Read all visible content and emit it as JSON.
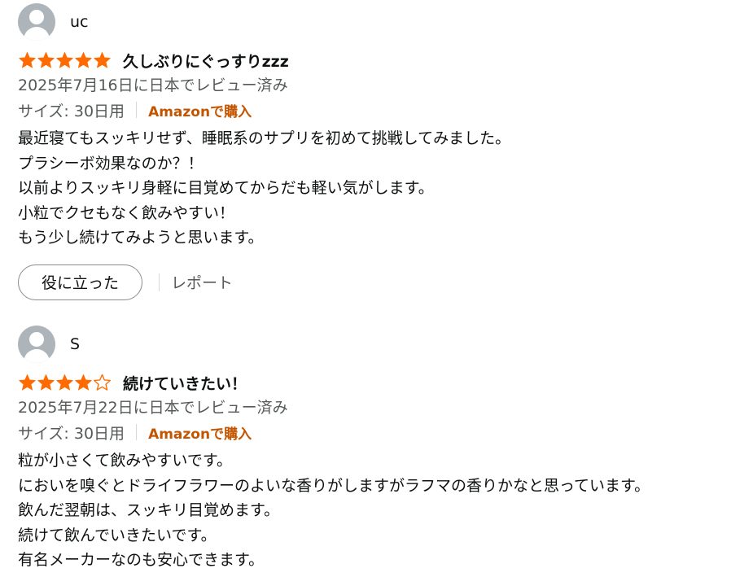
{
  "reviews": [
    {
      "reviewer": "uc",
      "rating": 5,
      "title": "久しぶりにぐっすりzzz",
      "date": "2025年7月16日に日本でレビュー済み",
      "size": "サイズ: 30日用",
      "verified": "Amazonで購入",
      "body": [
        "最近寝てもスッキリせず、睡眠系のサプリを初めて挑戦してみました。",
        "プラシーボ効果なのか？！",
        "以前よりスッキリ身軽に目覚めてからだも軽い気がします。",
        "小粒でクセもなく飲みやすい！",
        "もう少し続けてみようと思います。"
      ],
      "helpful_label": "役に立った",
      "report_label": "レポート"
    },
    {
      "reviewer": "S",
      "rating": 4,
      "title": "続けていきたい！",
      "date": "2025年7月22日に日本でレビュー済み",
      "size": "サイズ: 30日用",
      "verified": "Amazonで購入",
      "body": [
        "粒が小さくて飲みやすいです。",
        "においを嗅ぐとドライフラワーのよいな香りがしますがラフマの香りかなと思っています。",
        "飲んだ翌朝は、スッキリ目覚めます。",
        "続けて飲んでいきたいです。",
        "有名メーカーなのも安心できます。"
      ]
    }
  ],
  "colors": {
    "star": "#ff6b00",
    "verified": "#c45500",
    "muted": "#565959",
    "avatar": "#adb4ba"
  },
  "icons": {
    "star_filled": "star-icon",
    "star_empty": "star-outline-icon",
    "avatar": "user-avatar-icon"
  }
}
